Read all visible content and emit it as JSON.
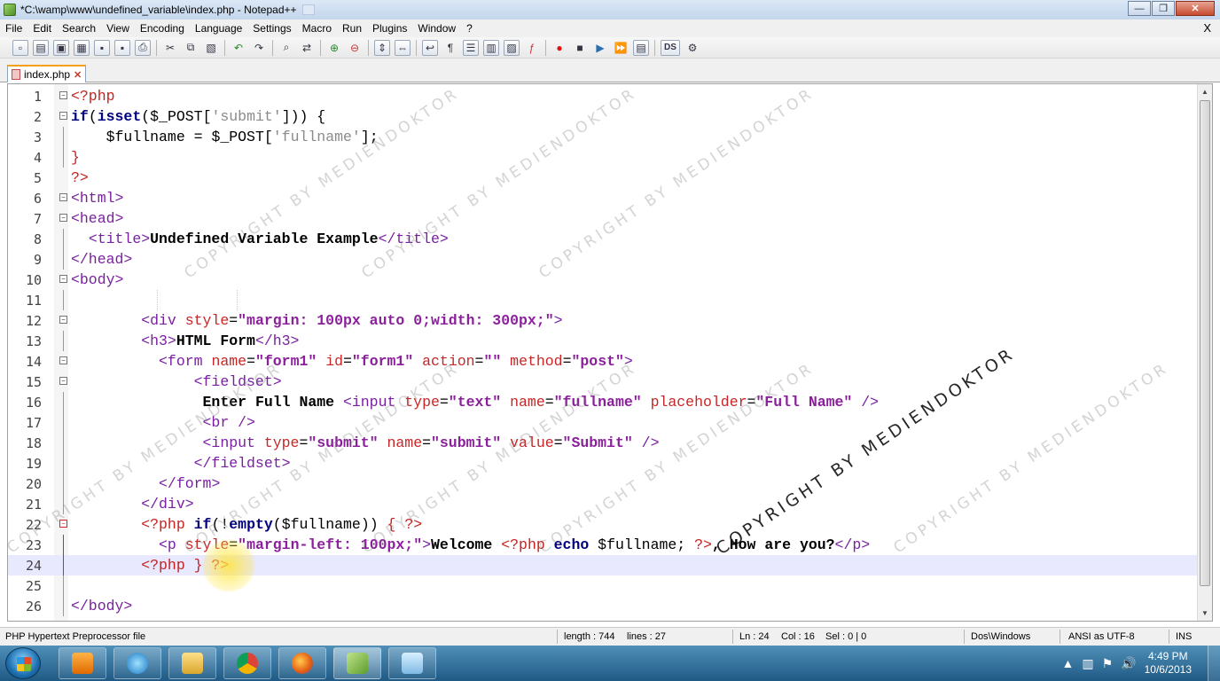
{
  "window": {
    "title": "*C:\\wamp\\www\\undefined_variable\\index.php - Notepad++",
    "minimize": "—",
    "maximize": "❐",
    "close": "✕"
  },
  "menubar": {
    "items": [
      "File",
      "Edit",
      "Search",
      "View",
      "Encoding",
      "Language",
      "Settings",
      "Macro",
      "Run",
      "Plugins",
      "Window",
      "?"
    ],
    "close_doc": "X"
  },
  "toolbar": {
    "icons": [
      "new-file-icon",
      "open-file-icon",
      "save-icon",
      "save-all-icon",
      "close-icon",
      "close-all-icon",
      "print-icon",
      "cut-icon",
      "copy-icon",
      "paste-icon",
      "undo-icon",
      "redo-icon",
      "find-icon",
      "replace-icon",
      "zoom-in-icon",
      "zoom-out-icon",
      "sync-vertical-icon",
      "sync-horizontal-icon",
      "word-wrap-icon",
      "show-all-chars-icon",
      "indent-guide-icon",
      "user-lang-icon",
      "doc-map-icon",
      "function-list-icon",
      "record-macro-icon",
      "stop-record-icon",
      "play-macro-icon",
      "run-macro-multiple-icon",
      "save-macro-icon",
      "ds-icon",
      "plugin-icon"
    ],
    "ds_label": "DS"
  },
  "tab": {
    "label": "index.php",
    "close": "✕"
  },
  "editor": {
    "line_numbers": [
      "1",
      "2",
      "3",
      "4",
      "5",
      "6",
      "7",
      "8",
      "9",
      "10",
      "11",
      "12",
      "13",
      "14",
      "15",
      "16",
      "17",
      "18",
      "19",
      "20",
      "21",
      "22",
      "23",
      "24",
      "25",
      "26"
    ],
    "current_line": 24
  },
  "statusbar": {
    "file_type": "PHP Hypertext Preprocessor file",
    "length": "length : 744",
    "lines": "lines : 27",
    "ln": "Ln : 24",
    "col": "Col : 16",
    "sel": "Sel : 0 | 0",
    "eol": "Dos\\Windows",
    "encoding": "ANSI as UTF-8",
    "mode": "INS"
  },
  "taskbar": {
    "apps": [
      "media-player-icon",
      "internet-explorer-icon",
      "file-explorer-icon",
      "chrome-icon",
      "firefox-icon",
      "notepadpp-icon",
      "notes-icon"
    ],
    "clock_time": "4:49 PM",
    "clock_date": "10/6/2013"
  },
  "watermark": {
    "text": "COPYRIGHT BY MEDIENDOKTOR"
  },
  "colors": {
    "php_tag": "#c5221f",
    "keyword": "#00007f",
    "html_tag": "#7a1fa2",
    "attribute": "#c72626",
    "attr_value": "#8b1f9c",
    "current_line_bg": "#e8e8ff",
    "fold_marker_active": "#dd2222",
    "taskbar": "#1f5a85"
  }
}
